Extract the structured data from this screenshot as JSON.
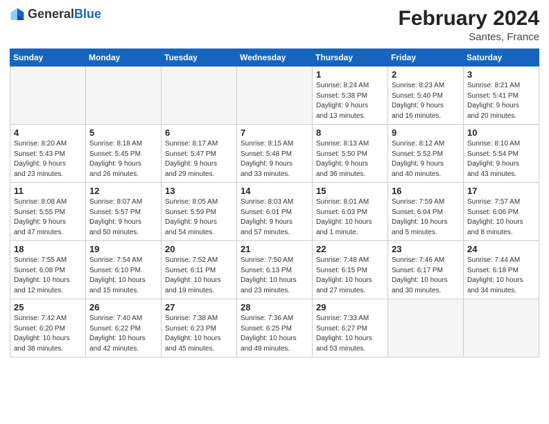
{
  "header": {
    "logo_general": "General",
    "logo_blue": "Blue",
    "month_year": "February 2024",
    "location": "Santes, France"
  },
  "days_of_week": [
    "Sunday",
    "Monday",
    "Tuesday",
    "Wednesday",
    "Thursday",
    "Friday",
    "Saturday"
  ],
  "weeks": [
    [
      {
        "day": "",
        "info": ""
      },
      {
        "day": "",
        "info": ""
      },
      {
        "day": "",
        "info": ""
      },
      {
        "day": "",
        "info": ""
      },
      {
        "day": "1",
        "info": "Sunrise: 8:24 AM\nSunset: 5:38 PM\nDaylight: 9 hours\nand 13 minutes."
      },
      {
        "day": "2",
        "info": "Sunrise: 8:23 AM\nSunset: 5:40 PM\nDaylight: 9 hours\nand 16 minutes."
      },
      {
        "day": "3",
        "info": "Sunrise: 8:21 AM\nSunset: 5:41 PM\nDaylight: 9 hours\nand 20 minutes."
      }
    ],
    [
      {
        "day": "4",
        "info": "Sunrise: 8:20 AM\nSunset: 5:43 PM\nDaylight: 9 hours\nand 23 minutes."
      },
      {
        "day": "5",
        "info": "Sunrise: 8:18 AM\nSunset: 5:45 PM\nDaylight: 9 hours\nand 26 minutes."
      },
      {
        "day": "6",
        "info": "Sunrise: 8:17 AM\nSunset: 5:47 PM\nDaylight: 9 hours\nand 29 minutes."
      },
      {
        "day": "7",
        "info": "Sunrise: 8:15 AM\nSunset: 5:48 PM\nDaylight: 9 hours\nand 33 minutes."
      },
      {
        "day": "8",
        "info": "Sunrise: 8:13 AM\nSunset: 5:50 PM\nDaylight: 9 hours\nand 36 minutes."
      },
      {
        "day": "9",
        "info": "Sunrise: 8:12 AM\nSunset: 5:52 PM\nDaylight: 9 hours\nand 40 minutes."
      },
      {
        "day": "10",
        "info": "Sunrise: 8:10 AM\nSunset: 5:54 PM\nDaylight: 9 hours\nand 43 minutes."
      }
    ],
    [
      {
        "day": "11",
        "info": "Sunrise: 8:08 AM\nSunset: 5:55 PM\nDaylight: 9 hours\nand 47 minutes."
      },
      {
        "day": "12",
        "info": "Sunrise: 8:07 AM\nSunset: 5:57 PM\nDaylight: 9 hours\nand 50 minutes."
      },
      {
        "day": "13",
        "info": "Sunrise: 8:05 AM\nSunset: 5:59 PM\nDaylight: 9 hours\nand 54 minutes."
      },
      {
        "day": "14",
        "info": "Sunrise: 8:03 AM\nSunset: 6:01 PM\nDaylight: 9 hours\nand 57 minutes."
      },
      {
        "day": "15",
        "info": "Sunrise: 8:01 AM\nSunset: 6:03 PM\nDaylight: 10 hours\nand 1 minute."
      },
      {
        "day": "16",
        "info": "Sunrise: 7:59 AM\nSunset: 6:04 PM\nDaylight: 10 hours\nand 5 minutes."
      },
      {
        "day": "17",
        "info": "Sunrise: 7:57 AM\nSunset: 6:06 PM\nDaylight: 10 hours\nand 8 minutes."
      }
    ],
    [
      {
        "day": "18",
        "info": "Sunrise: 7:55 AM\nSunset: 6:08 PM\nDaylight: 10 hours\nand 12 minutes."
      },
      {
        "day": "19",
        "info": "Sunrise: 7:54 AM\nSunset: 6:10 PM\nDaylight: 10 hours\nand 15 minutes."
      },
      {
        "day": "20",
        "info": "Sunrise: 7:52 AM\nSunset: 6:11 PM\nDaylight: 10 hours\nand 19 minutes."
      },
      {
        "day": "21",
        "info": "Sunrise: 7:50 AM\nSunset: 6:13 PM\nDaylight: 10 hours\nand 23 minutes."
      },
      {
        "day": "22",
        "info": "Sunrise: 7:48 AM\nSunset: 6:15 PM\nDaylight: 10 hours\nand 27 minutes."
      },
      {
        "day": "23",
        "info": "Sunrise: 7:46 AM\nSunset: 6:17 PM\nDaylight: 10 hours\nand 30 minutes."
      },
      {
        "day": "24",
        "info": "Sunrise: 7:44 AM\nSunset: 6:18 PM\nDaylight: 10 hours\nand 34 minutes."
      }
    ],
    [
      {
        "day": "25",
        "info": "Sunrise: 7:42 AM\nSunset: 6:20 PM\nDaylight: 10 hours\nand 38 minutes."
      },
      {
        "day": "26",
        "info": "Sunrise: 7:40 AM\nSunset: 6:22 PM\nDaylight: 10 hours\nand 42 minutes."
      },
      {
        "day": "27",
        "info": "Sunrise: 7:38 AM\nSunset: 6:23 PM\nDaylight: 10 hours\nand 45 minutes."
      },
      {
        "day": "28",
        "info": "Sunrise: 7:36 AM\nSunset: 6:25 PM\nDaylight: 10 hours\nand 49 minutes."
      },
      {
        "day": "29",
        "info": "Sunrise: 7:33 AM\nSunset: 6:27 PM\nDaylight: 10 hours\nand 53 minutes."
      },
      {
        "day": "",
        "info": ""
      },
      {
        "day": "",
        "info": ""
      }
    ]
  ]
}
